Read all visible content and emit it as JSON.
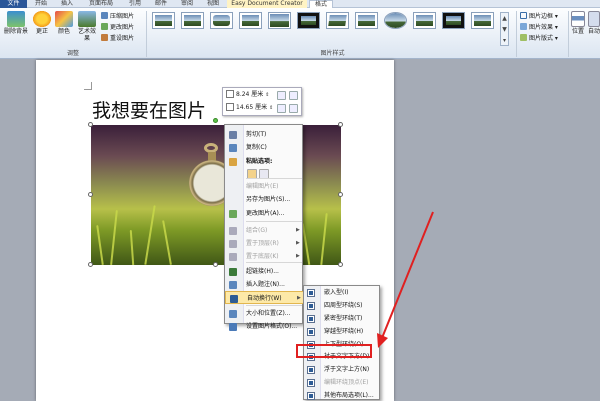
{
  "ribbon_tabs": [
    "文件",
    "开始",
    "插入",
    "页面布局",
    "引用",
    "邮件",
    "审阅",
    "视图",
    "Easy Document Creator",
    "格式"
  ],
  "ribbon": {
    "remove_bg": "删除背景",
    "correct": "更正",
    "color": "颜色",
    "art_effect": "艺术效果",
    "compress": "压缩图片",
    "change_pic": "更改图片",
    "reset_pic": "重设图片",
    "group_adjust": "调整",
    "group_styles": "图片样式",
    "border": "图片边框",
    "effects": "图片效果",
    "layout": "图片版式",
    "position": "位置",
    "auto": "自动"
  },
  "doc": {
    "heading": "我想要在图片"
  },
  "minibar": {
    "height": "8.24 厘米",
    "width": "14.65 厘米"
  },
  "context_menu": [
    {
      "label": "剪切(T)",
      "icon": "scissors-icon",
      "disabled": false
    },
    {
      "label": "复制(C)",
      "icon": "copy-icon",
      "disabled": false
    },
    {
      "label": "粘贴选项:",
      "icon": "paste-icon",
      "disabled": false,
      "header": true
    },
    {
      "label": "编辑图片(E)",
      "icon": "",
      "disabled": true
    },
    {
      "label": "另存为图片(S)...",
      "icon": "",
      "disabled": false
    },
    {
      "label": "更改图片(A)...",
      "icon": "change-picture-icon",
      "disabled": false
    },
    {
      "label": "组合(G)",
      "icon": "group-icon",
      "disabled": true,
      "submenu": true
    },
    {
      "label": "置于顶层(R)",
      "icon": "bring-front-icon",
      "disabled": true,
      "submenu": true
    },
    {
      "label": "置于底层(K)",
      "icon": "send-back-icon",
      "disabled": true,
      "submenu": true
    },
    {
      "label": "超链接(H)...",
      "icon": "hyperlink-icon",
      "disabled": false
    },
    {
      "label": "插入题注(N)...",
      "icon": "caption-icon",
      "disabled": false
    },
    {
      "label": "自动换行(W)",
      "icon": "wrap-icon",
      "disabled": false,
      "submenu": true,
      "highlighted": true
    },
    {
      "label": "大小和位置(Z)...",
      "icon": "size-position-icon",
      "disabled": false
    },
    {
      "label": "设置图片格式(O)...",
      "icon": "format-picture-icon",
      "disabled": false
    }
  ],
  "wrap_submenu": [
    {
      "label": "嵌入型(I)",
      "disabled": false
    },
    {
      "label": "四周型环绕(S)",
      "disabled": false
    },
    {
      "label": "紧密型环绕(T)",
      "disabled": false
    },
    {
      "label": "穿越型环绕(H)",
      "disabled": false
    },
    {
      "label": "上下型环绕(O)",
      "disabled": false
    },
    {
      "label": "衬于文字下方(D)",
      "disabled": false
    },
    {
      "label": "浮于文字上方(N)",
      "disabled": false
    },
    {
      "label": "编辑环绕顶点(E)",
      "disabled": true
    },
    {
      "label": "其他布局选项(L)...",
      "disabled": false
    }
  ],
  "colors": {
    "accent": "#2a5699",
    "highlight": "#fde9a8",
    "annotation": "#e02020"
  }
}
